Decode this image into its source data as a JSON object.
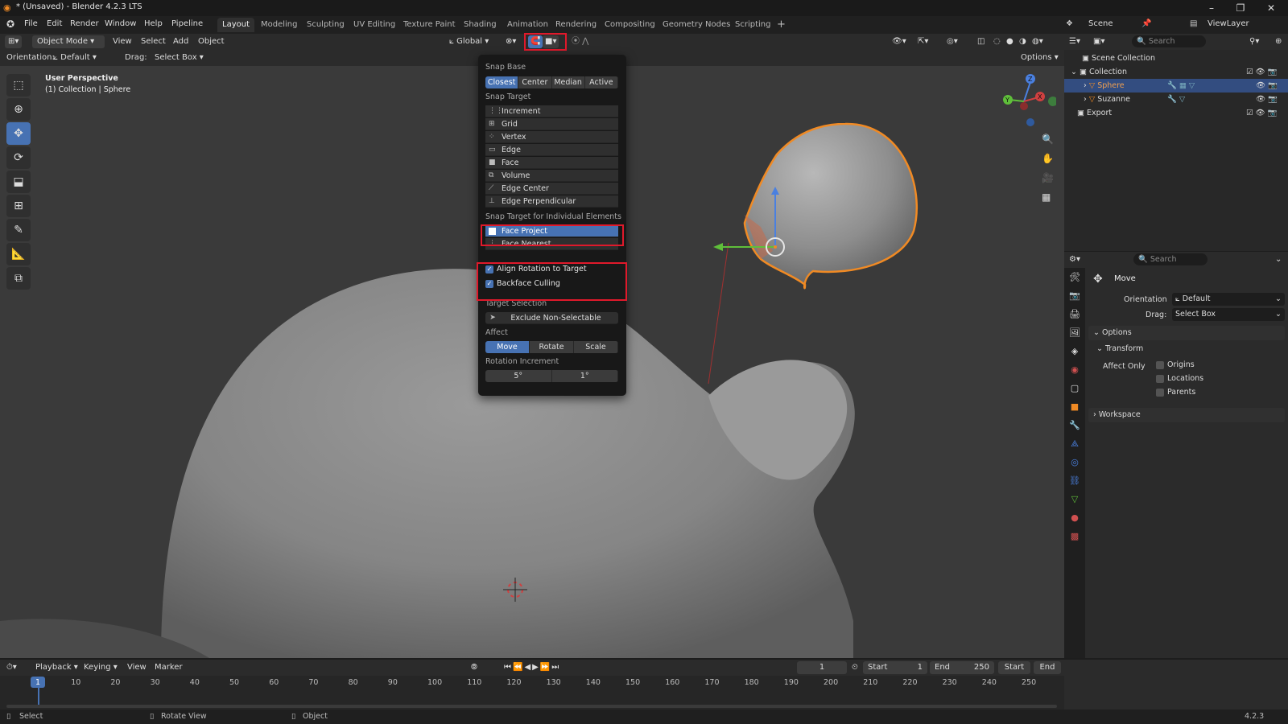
{
  "titlebar": {
    "title": "* (Unsaved) - Blender 4.2.3 LTS"
  },
  "menu": [
    "File",
    "Edit",
    "Render",
    "Window",
    "Help",
    "Pipeline"
  ],
  "workspaces": [
    "Layout",
    "Modeling",
    "Sculpting",
    "UV Editing",
    "Texture Paint",
    "Shading",
    "Animation",
    "Rendering",
    "Compositing",
    "Geometry Nodes",
    "Scripting"
  ],
  "scene": {
    "label": "Scene",
    "view_layer": "ViewLayer"
  },
  "viewport_header": {
    "mode": "Object Mode",
    "menus": [
      "View",
      "Select",
      "Add",
      "Object"
    ],
    "transform_orientation": "Global",
    "options": "Options",
    "orientation_label": "Orientation:",
    "orientation_value": "Default",
    "drag_label": "Drag:",
    "drag_value": "Select Box"
  },
  "viewport_info": {
    "line1": "User Perspective",
    "line2": "(1) Collection | Sphere"
  },
  "gizmo_axes": {
    "z": "Z",
    "y": "Y",
    "x": "X"
  },
  "snap_popover": {
    "snap_base_label": "Snap Base",
    "snap_base": [
      "Closest",
      "Center",
      "Median",
      "Active"
    ],
    "snap_base_selected": "Closest",
    "snap_target_label": "Snap Target",
    "snap_targets": [
      "Increment",
      "Grid",
      "Vertex",
      "Edge",
      "Face",
      "Volume",
      "Edge Center",
      "Edge Perpendicular"
    ],
    "individual_label": "Snap Target for Individual Elements",
    "individual": [
      "Face Project",
      "Face Nearest"
    ],
    "align_rotation": "Align Rotation to Target",
    "backface_culling": "Backface Culling",
    "target_selection_label": "Target Selection",
    "exclude_non_selectable": "Exclude Non-Selectable",
    "affect_label": "Affect",
    "affect": [
      "Move",
      "Rotate",
      "Scale"
    ],
    "rotation_increment_label": "Rotation Increment",
    "rotation_increment": [
      "5°",
      "1°"
    ]
  },
  "outliner": {
    "search_placeholder": "Search",
    "scene_collection": "Scene Collection",
    "collection": "Collection",
    "items": [
      "Sphere",
      "Suzanne"
    ],
    "export": "Export"
  },
  "properties": {
    "search_placeholder": "Search",
    "tool_name": "Move",
    "orientation_label": "Orientation",
    "orientation_value": "Default",
    "drag_label": "Drag:",
    "drag_value": "Select Box",
    "options_label": "Options",
    "transform_label": "Transform",
    "affect_only_label": "Affect Only",
    "affect_only": [
      "Origins",
      "Locations",
      "Parents"
    ],
    "workspace_label": "Workspace"
  },
  "timeline": {
    "menus": [
      "Playback",
      "Keying",
      "View",
      "Marker"
    ],
    "current_frame": "1",
    "start_label": "Start",
    "start_value": "1",
    "end_label": "End",
    "end_value": "250",
    "start_btn": "Start",
    "end_btn": "End",
    "ticks": [
      "1",
      "10",
      "20",
      "30",
      "40",
      "50",
      "60",
      "70",
      "80",
      "90",
      "100",
      "110",
      "120",
      "130",
      "140",
      "150",
      "160",
      "170",
      "180",
      "190",
      "200",
      "210",
      "220",
      "230",
      "240",
      "250"
    ]
  },
  "status": {
    "select": "Select",
    "rotate_view": "Rotate View",
    "object": "Object",
    "version": "4.2.3"
  }
}
